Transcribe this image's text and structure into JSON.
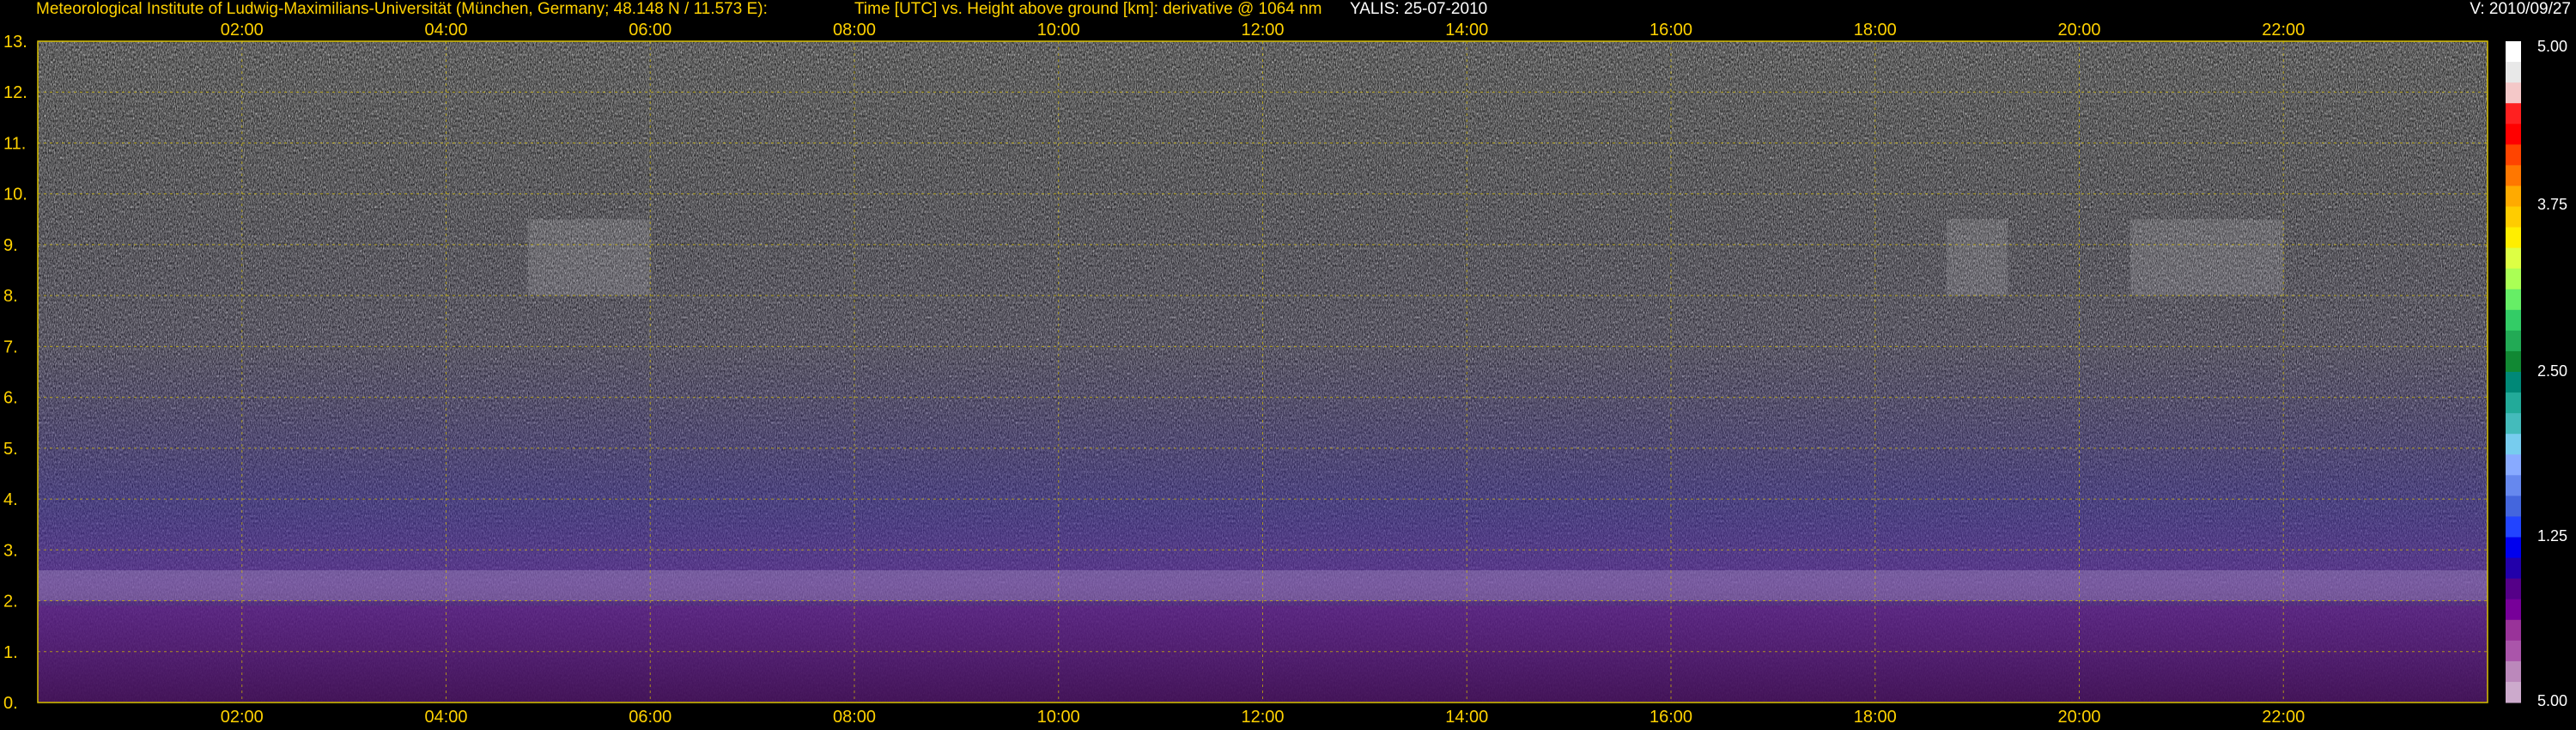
{
  "header": {
    "institute": "Meteorological Institute of Ludwig-Maximilians-Universität (München, Germany; 48.148 N / 11.573 E):",
    "description": "Time [UTC] vs. Height above ground [km]: derivative @ 1064 nm",
    "station_date": "YALIS: 25-07-2010",
    "version": "V: 2010/09/27"
  },
  "chart_data": {
    "type": "heatmap",
    "title": "Time [UTC] vs. Height above ground [km]: derivative @ 1064 nm",
    "xlabel": "Time [UTC]",
    "ylabel": "Height above ground [km]",
    "x_tick_labels": [
      "02:00",
      "04:00",
      "06:00",
      "08:00",
      "10:00",
      "12:00",
      "14:00",
      "16:00",
      "18:00",
      "20:00",
      "22:00"
    ],
    "x_tick_hours": [
      2,
      4,
      6,
      8,
      10,
      12,
      14,
      16,
      18,
      20,
      22
    ],
    "xlim_hours": [
      0,
      24
    ],
    "y_tick_labels": [
      "0.",
      "1.",
      "2.",
      "3.",
      "4.",
      "5.",
      "6.",
      "7.",
      "8.",
      "9.",
      "10.",
      "11.",
      "12.",
      "13."
    ],
    "y_ticks_km": [
      0,
      1,
      2,
      3,
      4,
      5,
      6,
      7,
      8,
      9,
      10,
      11,
      12,
      13
    ],
    "ylim_km": [
      0,
      13
    ],
    "grid": true,
    "colorbar": {
      "labels": [
        "5.00",
        "3.75",
        "2.50",
        "1.25",
        "5.00"
      ],
      "label_values": [
        5.0,
        3.75,
        2.5,
        1.25,
        5.0
      ],
      "colors": [
        "#ffffff",
        "#e8e8e8",
        "#f4c8c8",
        "#ff2020",
        "#ff0000",
        "#ff4400",
        "#ff7700",
        "#ffaa00",
        "#ffcc00",
        "#ffee00",
        "#ddff44",
        "#aaff55",
        "#66ee66",
        "#33cc66",
        "#22aa55",
        "#118833",
        "#008877",
        "#22aa99",
        "#44bbbb",
        "#77ccee",
        "#88aaff",
        "#6688ee",
        "#4466dd",
        "#2244ff",
        "#0000ee",
        "#2200aa",
        "#550088",
        "#770099",
        "#993399",
        "#aa55aa",
        "#bb88bb",
        "#ccaacc"
      ]
    },
    "features": [
      {
        "name": "boundary layer top",
        "height_km": [
          2.0,
          2.6
        ]
      },
      {
        "name": "cloud patches",
        "time_hours": [
          [
            4.8,
            6.0
          ],
          [
            18.7,
            19.3
          ],
          [
            20.5,
            22.0
          ]
        ],
        "height_km": [
          8.0,
          9.5
        ]
      }
    ]
  }
}
